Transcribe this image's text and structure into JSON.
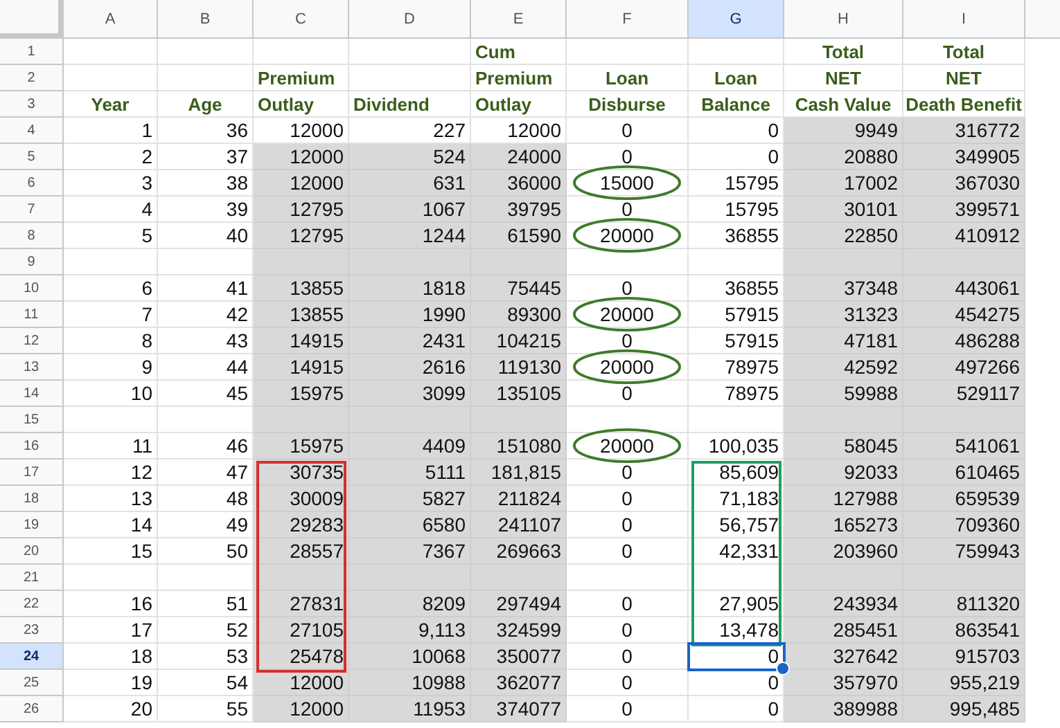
{
  "columns": [
    {
      "letter": "A",
      "selected": false
    },
    {
      "letter": "B",
      "selected": false
    },
    {
      "letter": "C",
      "selected": false,
      "color": "#d32f2f"
    },
    {
      "letter": "D",
      "selected": false
    },
    {
      "letter": "E",
      "selected": false
    },
    {
      "letter": "F",
      "selected": false
    },
    {
      "letter": "G",
      "selected": true,
      "color": "#1e9e63"
    },
    {
      "letter": "H",
      "selected": false
    },
    {
      "letter": "I",
      "selected": false
    }
  ],
  "rows": [
    {
      "number": "1",
      "kind": "header",
      "selected": false,
      "cells": [
        {},
        {},
        {},
        {},
        {
          "text": "Cum"
        },
        {},
        {},
        {
          "text": "Total"
        },
        {
          "text": "Total"
        }
      ]
    },
    {
      "number": "2",
      "kind": "header",
      "selected": false,
      "cells": [
        {},
        {},
        {
          "text": "Premium"
        },
        {},
        {
          "text": "Premium"
        },
        {
          "text": "Loan"
        },
        {
          "text": "Loan"
        },
        {
          "text": "NET"
        },
        {
          "text": "NET"
        }
      ]
    },
    {
      "number": "3",
      "kind": "header",
      "selected": false,
      "cells": [
        {
          "text": "Year"
        },
        {
          "text": "Age"
        },
        {
          "text": "Outlay"
        },
        {
          "text": "Dividend"
        },
        {
          "text": "Outlay"
        },
        {
          "text": "Disburse"
        },
        {
          "text": "Balance"
        },
        {
          "text": "Cash Value"
        },
        {
          "text": "Death Benefit"
        }
      ]
    },
    {
      "number": "4",
      "kind": "lead",
      "selected": false,
      "cells": [
        {
          "text": "1"
        },
        {
          "text": "36"
        },
        {
          "text": "12000"
        },
        {
          "text": "227"
        },
        {
          "text": "12000"
        },
        {
          "text": "0",
          "circled": false
        },
        {
          "text": "0"
        },
        {
          "text": "9949"
        },
        {
          "text": "316772"
        }
      ]
    },
    {
      "number": "5",
      "kind": "data",
      "selected": false,
      "cells": [
        {
          "text": "2"
        },
        {
          "text": "37"
        },
        {
          "text": "12000"
        },
        {
          "text": "524"
        },
        {
          "text": "24000"
        },
        {
          "text": "0",
          "circled": false
        },
        {
          "text": "0"
        },
        {
          "text": "20880"
        },
        {
          "text": "349905"
        }
      ]
    },
    {
      "number": "6",
      "kind": "data",
      "selected": false,
      "cells": [
        {
          "text": "3"
        },
        {
          "text": "38"
        },
        {
          "text": "12000"
        },
        {
          "text": "631"
        },
        {
          "text": "36000"
        },
        {
          "text": "15000",
          "circled": true
        },
        {
          "text": "15795"
        },
        {
          "text": "17002"
        },
        {
          "text": "367030"
        }
      ]
    },
    {
      "number": "7",
      "kind": "data",
      "selected": false,
      "cells": [
        {
          "text": "4"
        },
        {
          "text": "39"
        },
        {
          "text": "12795"
        },
        {
          "text": "1067"
        },
        {
          "text": "39795"
        },
        {
          "text": "0",
          "circled": false
        },
        {
          "text": "15795"
        },
        {
          "text": "30101"
        },
        {
          "text": "399571"
        }
      ]
    },
    {
      "number": "8",
      "kind": "data",
      "selected": false,
      "cells": [
        {
          "text": "5"
        },
        {
          "text": "40"
        },
        {
          "text": "12795"
        },
        {
          "text": "1244"
        },
        {
          "text": "61590"
        },
        {
          "text": "20000",
          "circled": true
        },
        {
          "text": "36855"
        },
        {
          "text": "22850"
        },
        {
          "text": "410912"
        }
      ]
    },
    {
      "number": "9",
      "kind": "data",
      "selected": false,
      "cells": [
        {},
        {},
        {},
        {},
        {},
        {},
        {},
        {},
        {}
      ]
    },
    {
      "number": "10",
      "kind": "data",
      "selected": false,
      "cells": [
        {
          "text": "6"
        },
        {
          "text": "41"
        },
        {
          "text": "13855"
        },
        {
          "text": "1818"
        },
        {
          "text": "75445"
        },
        {
          "text": "0",
          "circled": false
        },
        {
          "text": "36855"
        },
        {
          "text": "37348"
        },
        {
          "text": "443061"
        }
      ]
    },
    {
      "number": "11",
      "kind": "data",
      "selected": false,
      "cells": [
        {
          "text": "7"
        },
        {
          "text": "42"
        },
        {
          "text": "13855"
        },
        {
          "text": "1990"
        },
        {
          "text": "89300"
        },
        {
          "text": "20000",
          "circled": true
        },
        {
          "text": "57915"
        },
        {
          "text": "31323"
        },
        {
          "text": "454275"
        }
      ]
    },
    {
      "number": "12",
      "kind": "data",
      "selected": false,
      "cells": [
        {
          "text": "8"
        },
        {
          "text": "43"
        },
        {
          "text": "14915"
        },
        {
          "text": "2431"
        },
        {
          "text": "104215"
        },
        {
          "text": "0",
          "circled": false
        },
        {
          "text": "57915"
        },
        {
          "text": "47181"
        },
        {
          "text": "486288"
        }
      ]
    },
    {
      "number": "13",
      "kind": "data",
      "selected": false,
      "cells": [
        {
          "text": "9"
        },
        {
          "text": "44"
        },
        {
          "text": "14915"
        },
        {
          "text": "2616"
        },
        {
          "text": "119130"
        },
        {
          "text": "20000",
          "circled": true
        },
        {
          "text": "78975"
        },
        {
          "text": "42592"
        },
        {
          "text": "497266"
        }
      ]
    },
    {
      "number": "14",
      "kind": "data",
      "selected": false,
      "cells": [
        {
          "text": "10"
        },
        {
          "text": "45"
        },
        {
          "text": "15975"
        },
        {
          "text": "3099"
        },
        {
          "text": "135105"
        },
        {
          "text": "0",
          "circled": false
        },
        {
          "text": "78975"
        },
        {
          "text": "59988"
        },
        {
          "text": "529117"
        }
      ]
    },
    {
      "number": "15",
      "kind": "data",
      "selected": false,
      "cells": [
        {},
        {},
        {},
        {},
        {},
        {},
        {},
        {},
        {}
      ]
    },
    {
      "number": "16",
      "kind": "data",
      "selected": false,
      "cells": [
        {
          "text": "11"
        },
        {
          "text": "46"
        },
        {
          "text": "15975"
        },
        {
          "text": "4409"
        },
        {
          "text": "151080"
        },
        {
          "text": "20000",
          "circled": true
        },
        {
          "text": "100,035"
        },
        {
          "text": "58045"
        },
        {
          "text": "541061"
        }
      ]
    },
    {
      "number": "17",
      "kind": "data",
      "selected": false,
      "cells": [
        {
          "text": "12"
        },
        {
          "text": "47"
        },
        {
          "text": "30735",
          "outlined": true
        },
        {
          "text": "5111"
        },
        {
          "text": "181,815"
        },
        {
          "text": "0",
          "circled": false
        },
        {
          "text": "85,609",
          "outlined": true
        },
        {
          "text": "92033"
        },
        {
          "text": "610465"
        }
      ]
    },
    {
      "number": "18",
      "kind": "data",
      "selected": false,
      "cells": [
        {
          "text": "13"
        },
        {
          "text": "48"
        },
        {
          "text": "30009",
          "outlined": true
        },
        {
          "text": "5827"
        },
        {
          "text": "211824"
        },
        {
          "text": "0",
          "circled": false
        },
        {
          "text": "71,183",
          "outlined": true
        },
        {
          "text": "127988"
        },
        {
          "text": "659539"
        }
      ]
    },
    {
      "number": "19",
      "kind": "data",
      "selected": false,
      "cells": [
        {
          "text": "14"
        },
        {
          "text": "49"
        },
        {
          "text": "29283",
          "outlined": true
        },
        {
          "text": "6580"
        },
        {
          "text": "241107"
        },
        {
          "text": "0",
          "circled": false
        },
        {
          "text": "56,757",
          "outlined": true
        },
        {
          "text": "165273"
        },
        {
          "text": "709360"
        }
      ]
    },
    {
      "number": "20",
      "kind": "data",
      "selected": false,
      "cells": [
        {
          "text": "15"
        },
        {
          "text": "50"
        },
        {
          "text": "28557",
          "outlined": true
        },
        {
          "text": "7367"
        },
        {
          "text": "269663"
        },
        {
          "text": "0",
          "circled": false
        },
        {
          "text": "42,331",
          "outlined": true
        },
        {
          "text": "203960"
        },
        {
          "text": "759943"
        }
      ]
    },
    {
      "number": "21",
      "kind": "data",
      "selected": false,
      "cells": [
        {},
        {},
        {
          "outlined": true
        },
        {},
        {},
        {},
        {
          "outlined": true
        },
        {},
        {}
      ]
    },
    {
      "number": "22",
      "kind": "data",
      "selected": false,
      "cells": [
        {
          "text": "16"
        },
        {
          "text": "51"
        },
        {
          "text": "27831",
          "outlined": true
        },
        {
          "text": "8209"
        },
        {
          "text": "297494"
        },
        {
          "text": "0",
          "circled": false
        },
        {
          "text": "27,905",
          "outlined": true
        },
        {
          "text": "243934"
        },
        {
          "text": "811320"
        }
      ]
    },
    {
      "number": "23",
      "kind": "data",
      "selected": false,
      "cells": [
        {
          "text": "17"
        },
        {
          "text": "52"
        },
        {
          "text": "27105",
          "outlined": true
        },
        {
          "text": "9,113"
        },
        {
          "text": "324599"
        },
        {
          "text": "0",
          "circled": false
        },
        {
          "text": "13,478",
          "outlined": true
        },
        {
          "text": "285451"
        },
        {
          "text": "863541"
        }
      ]
    },
    {
      "number": "24",
      "kind": "data",
      "selected": true,
      "cells": [
        {
          "text": "18"
        },
        {
          "text": "53"
        },
        {
          "text": "25478",
          "outlined": true
        },
        {
          "text": "10068"
        },
        {
          "text": "350077"
        },
        {
          "text": "0",
          "circled": false
        },
        {
          "text": "0",
          "outlined": false
        },
        {
          "text": "327642"
        },
        {
          "text": "915703"
        }
      ]
    },
    {
      "number": "25",
      "kind": "data",
      "selected": false,
      "cells": [
        {
          "text": "19"
        },
        {
          "text": "54"
        },
        {
          "text": "12000"
        },
        {
          "text": "10988"
        },
        {
          "text": "362077"
        },
        {
          "text": "0",
          "circled": false
        },
        {
          "text": "0"
        },
        {
          "text": "357970"
        },
        {
          "text": "955,219"
        }
      ]
    },
    {
      "number": "26",
      "kind": "data",
      "selected": false,
      "cells": [
        {
          "text": "20"
        },
        {
          "text": "55"
        },
        {
          "text": "12000"
        },
        {
          "text": "11953"
        },
        {
          "text": "374077"
        },
        {
          "text": "0",
          "circled": false
        },
        {
          "text": "0"
        },
        {
          "text": "389988"
        },
        {
          "text": "995,485"
        }
      ]
    }
  ]
}
